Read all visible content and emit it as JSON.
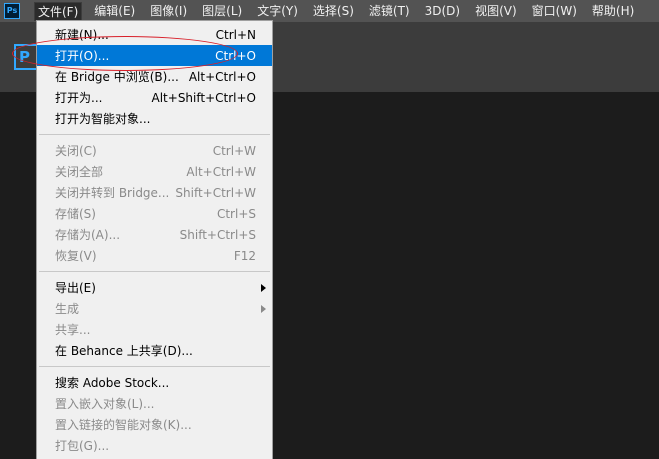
{
  "app": {
    "logo_text": "Ps",
    "panel_letter": "P",
    "accent": "#31a8ff"
  },
  "menubar": {
    "items": [
      {
        "label": "文件(F)",
        "active": true
      },
      {
        "label": "编辑(E)"
      },
      {
        "label": "图像(I)"
      },
      {
        "label": "图层(L)"
      },
      {
        "label": "文字(Y)"
      },
      {
        "label": "选择(S)"
      },
      {
        "label": "滤镜(T)"
      },
      {
        "label": "3D(D)"
      },
      {
        "label": "视图(V)"
      },
      {
        "label": "窗口(W)"
      },
      {
        "label": "帮助(H)"
      }
    ]
  },
  "file_menu": {
    "group1": [
      {
        "label": "新建(N)...",
        "shortcut": "Ctrl+N"
      },
      {
        "label": "打开(O)...",
        "shortcut": "Ctrl+O"
      },
      {
        "label": "在 Bridge 中浏览(B)...",
        "shortcut": "Alt+Ctrl+O"
      },
      {
        "label": "打开为...",
        "shortcut": "Alt+Shift+Ctrl+O"
      },
      {
        "label": "打开为智能对象...",
        "shortcut": ""
      }
    ],
    "group2": [
      {
        "label": "关闭(C)",
        "shortcut": "Ctrl+W"
      },
      {
        "label": "关闭全部",
        "shortcut": "Alt+Ctrl+W"
      },
      {
        "label": "关闭并转到 Bridge...",
        "shortcut": "Shift+Ctrl+W"
      },
      {
        "label": "存储(S)",
        "shortcut": "Ctrl+S"
      },
      {
        "label": "存储为(A)...",
        "shortcut": "Shift+Ctrl+S"
      },
      {
        "label": "恢复(V)",
        "shortcut": "F12"
      }
    ],
    "group3": [
      {
        "label": "导出(E)",
        "shortcut": ""
      },
      {
        "label": "生成",
        "shortcut": ""
      },
      {
        "label": "共享...",
        "shortcut": ""
      },
      {
        "label": "在 Behance 上共享(D)...",
        "shortcut": ""
      }
    ],
    "group4": [
      {
        "label": "搜索 Adobe Stock...",
        "shortcut": ""
      },
      {
        "label": "置入嵌入对象(L)...",
        "shortcut": ""
      },
      {
        "label": "置入链接的智能对象(K)...",
        "shortcut": ""
      },
      {
        "label": "打包(G)...",
        "shortcut": ""
      }
    ],
    "highlight_color": "#0078d7",
    "annotation_color": "#d8202a"
  }
}
